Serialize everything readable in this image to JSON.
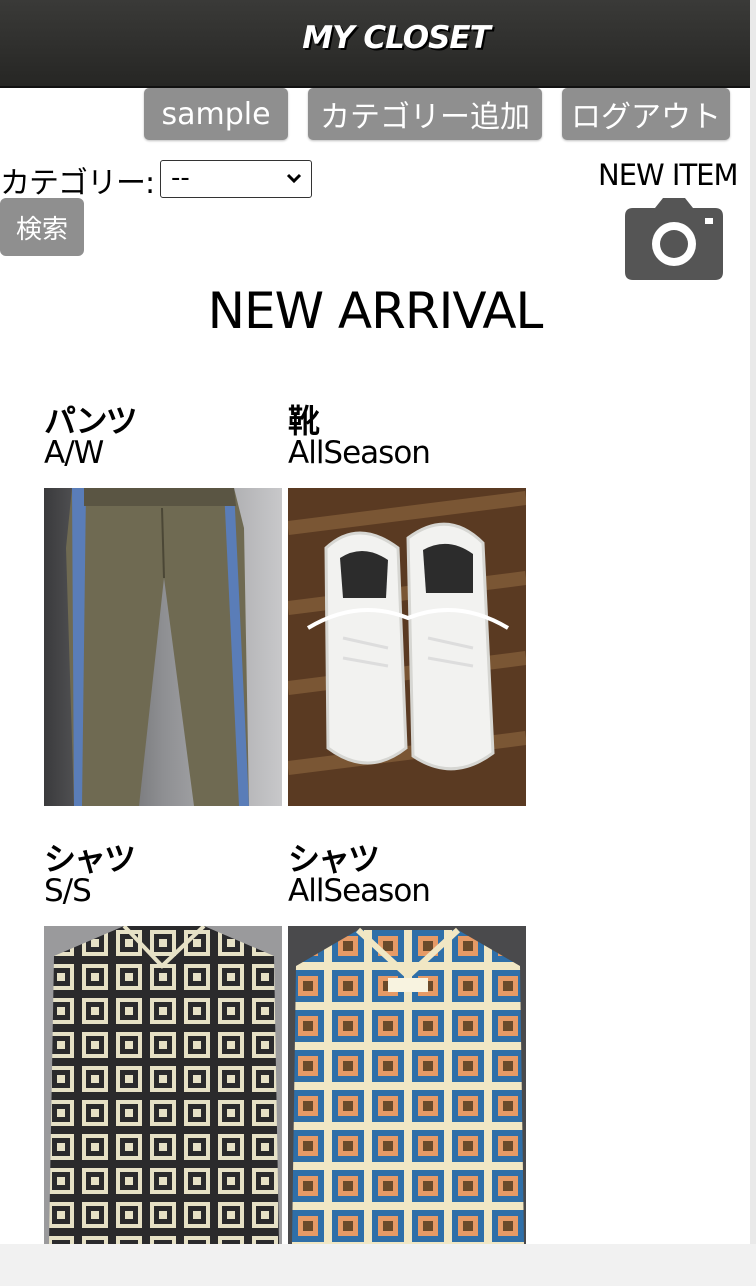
{
  "header": {
    "title": "MY CLOSET"
  },
  "toolbar": {
    "sample_label": "sample",
    "add_category_label": "カテゴリー追加",
    "logout_label": "ログアウト"
  },
  "filter": {
    "category_label": "カテゴリー:",
    "selected": "--",
    "search_label": "検索"
  },
  "new_item": {
    "label": "NEW ITEM",
    "icon": "camera-icon"
  },
  "section": {
    "title": "NEW ARRIVAL"
  },
  "items": [
    {
      "category": "パンツ",
      "season": "A/W"
    },
    {
      "category": "靴",
      "season": "AllSeason"
    },
    {
      "category": "シャツ",
      "season": "S/S"
    },
    {
      "category": "シャツ",
      "season": "AllSeason"
    }
  ],
  "colors": {
    "header_bg": "#2f2f2d",
    "button_bg": "#8f8f8f",
    "icon": "#555555"
  }
}
